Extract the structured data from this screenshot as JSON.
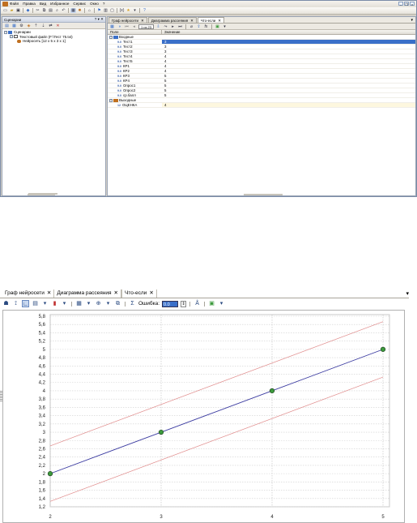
{
  "top_window": {
    "menu": [
      "Файл",
      "Правка",
      "Вид",
      "Избранное",
      "Сервис",
      "Окно",
      "?"
    ],
    "left_pane": {
      "title": "Сценарии",
      "pin_glyphs": "? ▾ ✕",
      "tree": [
        {
          "label": "Сценарии",
          "level": 0,
          "toggle": "−"
        },
        {
          "label": "Текстовый файл (F:\\Тест 75.txt)",
          "level": 1,
          "toggle": "−"
        },
        {
          "label": "Нейросеть [12 x 5 x 3 x 1]",
          "level": 2,
          "toggle": ""
        }
      ]
    },
    "right_pane": {
      "tabs": [
        {
          "label": "Граф нейросети",
          "close": "✕",
          "active": false
        },
        {
          "label": "Диаграмма рассеяния",
          "close": "✕",
          "active": false
        },
        {
          "label": "Что-если",
          "close": "✕",
          "active": true
        }
      ],
      "pager": "1 из 23",
      "grid_headers": [
        "Поле",
        "Значение"
      ],
      "groups": [
        {
          "name": "Входные",
          "toggle": "−",
          "rows": [
            {
              "tag": "9.0",
              "field": "Тест1",
              "value": "3",
              "selected": true
            },
            {
              "tag": "9.0",
              "field": "Тест2",
              "value": "3"
            },
            {
              "tag": "9.0",
              "field": "Тест3",
              "value": "3"
            },
            {
              "tag": "9.0",
              "field": "Тест4",
              "value": "4"
            },
            {
              "tag": "9.0",
              "field": "Тест5",
              "value": "4"
            },
            {
              "tag": "9.0",
              "field": "КР1",
              "value": "4"
            },
            {
              "tag": "9.0",
              "field": "КР2",
              "value": "4"
            },
            {
              "tag": "9.0",
              "field": "КР3",
              "value": "5"
            },
            {
              "tag": "9.0",
              "field": "КР4",
              "value": "5"
            },
            {
              "tag": "9.0",
              "field": "Опрос1",
              "value": "5"
            },
            {
              "tag": "9.0",
              "field": "Опрос2",
              "value": "5"
            },
            {
              "tag": "9.0",
              "field": "ср.балл",
              "value": "5"
            }
          ]
        },
        {
          "name": "Выходные",
          "toggle": "−",
          "rows": [
            {
              "tag": "12",
              "field": "ОЦЕНКА",
              "value": "4",
              "highlight": true
            }
          ]
        }
      ]
    }
  },
  "bottom_window": {
    "tabs": [
      {
        "label": "Граф нейросети",
        "close": "✕"
      },
      {
        "label": "Диаграмма рассеяния",
        "close": "✕"
      },
      {
        "label": "Что-если",
        "close": "✕"
      }
    ],
    "dropdown_glyph": "▾",
    "error_label": "Ошибка:",
    "error_value": "0.0",
    "chart_data": {
      "type": "line",
      "x_ticks": [
        2,
        3,
        4,
        5
      ],
      "y_ticks": [
        "1,2",
        "1,4",
        "1,6",
        "1,8",
        "2",
        "2,2",
        "2,4",
        "2,6",
        "2,8",
        "3",
        "3,2",
        "3,4",
        "3,6",
        "3,8",
        "4",
        "4,2",
        "4,4",
        "4,6",
        "4,8",
        "5",
        "5,2",
        "5,4",
        "5,6",
        "5,8"
      ],
      "xlim": [
        2,
        5
      ],
      "ylim": [
        1.2,
        5.8
      ],
      "grid": true,
      "series": [
        {
          "role": "main",
          "x": [
            2,
            3,
            4,
            5
          ],
          "y": [
            2,
            3,
            4,
            5
          ],
          "color": "#3a3aa0",
          "points": true,
          "point_color": "#3c9a3c"
        },
        {
          "role": "upper",
          "x": [
            2,
            5
          ],
          "y": [
            2.67,
            5.67
          ],
          "color": "#e08a8a",
          "points": false
        },
        {
          "role": "lower",
          "x": [
            2,
            5
          ],
          "y": [
            1.33,
            4.33
          ],
          "color": "#e08a8a",
          "points": false
        }
      ]
    }
  }
}
